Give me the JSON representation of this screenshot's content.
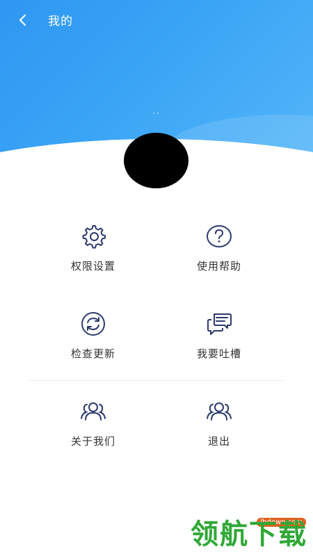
{
  "header": {
    "title": "我的",
    "username": "··"
  },
  "menu": [
    {
      "label": "权限设置",
      "icon": "gear-icon"
    },
    {
      "label": "使用帮助",
      "icon": "help-circle-icon"
    },
    {
      "label": "检查更新",
      "icon": "refresh-icon"
    },
    {
      "label": "我要吐槽",
      "icon": "chat-bubbles-icon"
    },
    {
      "label": "关于我们",
      "icon": "group-icon"
    },
    {
      "label": "退出",
      "icon": "logout-group-icon"
    }
  ],
  "watermark": {
    "text": "领航下载",
    "site": "lhdown.com"
  },
  "colors": {
    "header_start": "#2f97f2",
    "header_end": "#55b6fa",
    "icon": "#2b3a6e",
    "text": "#333333",
    "watermark": "#31a838"
  }
}
